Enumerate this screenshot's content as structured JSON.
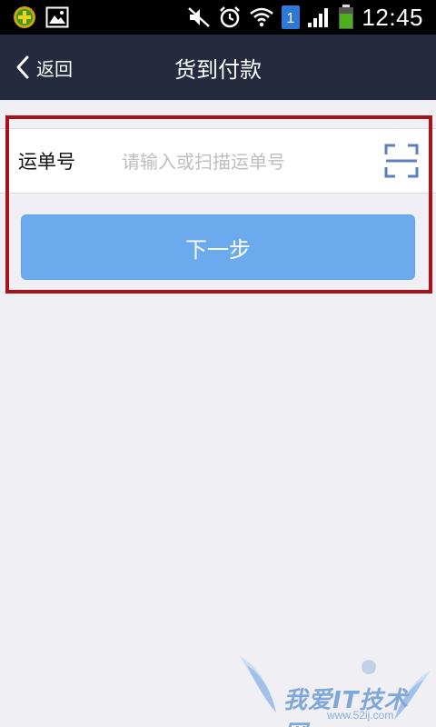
{
  "status_bar": {
    "time": "12:45",
    "sim_slot": "1",
    "icons": [
      "app-notification-icon",
      "image-notification-icon",
      "mute-icon",
      "alarm-icon",
      "wifi-icon",
      "sim-icon",
      "signal-icon",
      "battery-icon"
    ],
    "battery_color": "#4caf1e"
  },
  "nav": {
    "back_label": "返回",
    "title": "货到付款",
    "background": "#262a3f"
  },
  "form": {
    "field_label": "运单号",
    "field_placeholder": "请输入或扫描运单号",
    "field_value": "",
    "scan_icon": "scan-icon",
    "scan_color": "#5b7fbf"
  },
  "next_button": {
    "label": "下一步",
    "color": "#6aaaed"
  },
  "highlight_color": "#a8121d",
  "watermark": {
    "text": "我爱IT技术网",
    "sub": "www.52ij.com"
  }
}
